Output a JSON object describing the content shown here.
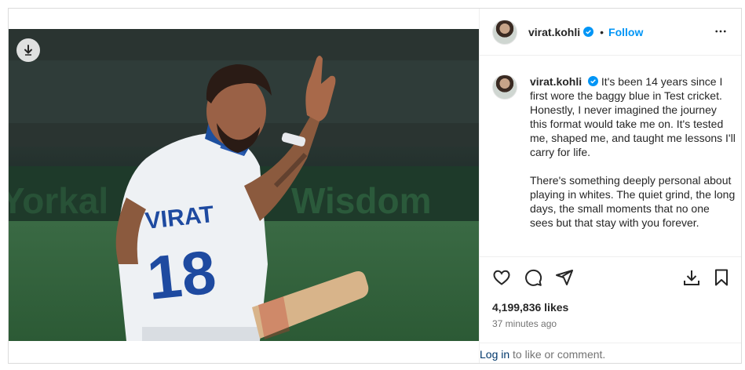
{
  "post": {
    "username": "virat.kohli",
    "follow_label": "Follow",
    "separator": "•",
    "caption_paragraphs": [
      "It's been 14 years since I first wore the baggy blue in Test cricket. Honestly, I never imagined the journey this format would take me on. It's tested me, shaped me, and taught me lessons I'll carry for life.",
      "There's something deeply personal about playing in whites. The quiet grind, the long days, the small moments that no one sees but that stay with you forever."
    ],
    "likes": "4,199,836 likes",
    "time": "37 minutes ago",
    "login_link": "Log in",
    "login_rest": " to like or comment.",
    "jersey_name": "VIRAT",
    "jersey_number": "18"
  },
  "icons": {
    "download_badge": "download-icon",
    "verified": "verified-badge-icon",
    "more": "more-options-icon",
    "like": "heart-icon",
    "comment": "comment-icon",
    "share": "share-icon",
    "save_download": "download-icon",
    "bookmark": "bookmark-icon"
  },
  "colors": {
    "follow": "#0095f6",
    "verified": "#0095f6",
    "muted": "#737373",
    "text": "#262626"
  }
}
